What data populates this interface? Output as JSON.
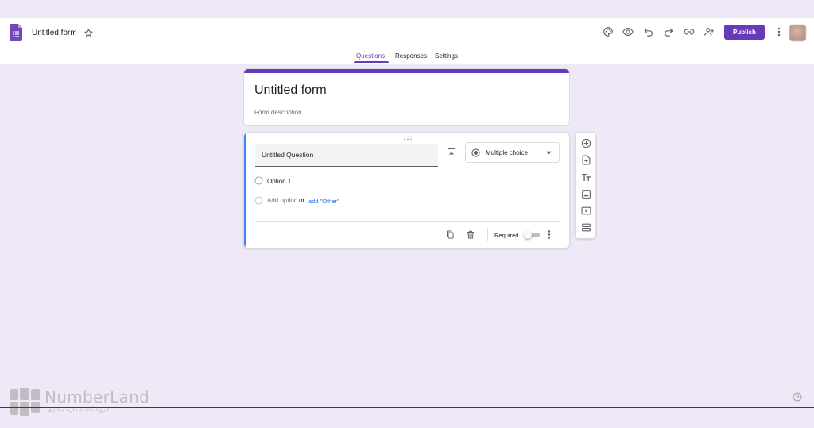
{
  "header": {
    "doc_title": "Untitled form",
    "publish_label": "Publish",
    "icons": [
      "customize-theme-icon",
      "preview-icon",
      "undo-icon",
      "redo-icon",
      "link-icon",
      "add-collaborator-icon",
      "more-vert-icon"
    ]
  },
  "tabs": [
    {
      "label": "Questions",
      "active": true
    },
    {
      "label": "Responses",
      "active": false
    },
    {
      "label": "Settings",
      "active": false
    }
  ],
  "form": {
    "title": "Untitled form",
    "description_placeholder": "Form description"
  },
  "question": {
    "title": "Untitled Question",
    "type": "Multiple choice",
    "options": [
      "Option 1"
    ],
    "add_option_label": "Add option",
    "or_label": "or",
    "add_other_label": "add \"Other\"",
    "required_label": "Required",
    "required": false
  },
  "side_toolbar": [
    "add-question-icon",
    "import-questions-icon",
    "add-title-icon",
    "add-image-icon",
    "add-video-icon",
    "add-section-icon"
  ],
  "watermark": {
    "name": "NumberLand",
    "tagline": "فروشگاه شماره مجازی"
  },
  "colors": {
    "accent": "#673ab7",
    "background": "#efe9f7",
    "active_question_bar": "#4285f4",
    "link": "#1a73e8"
  }
}
